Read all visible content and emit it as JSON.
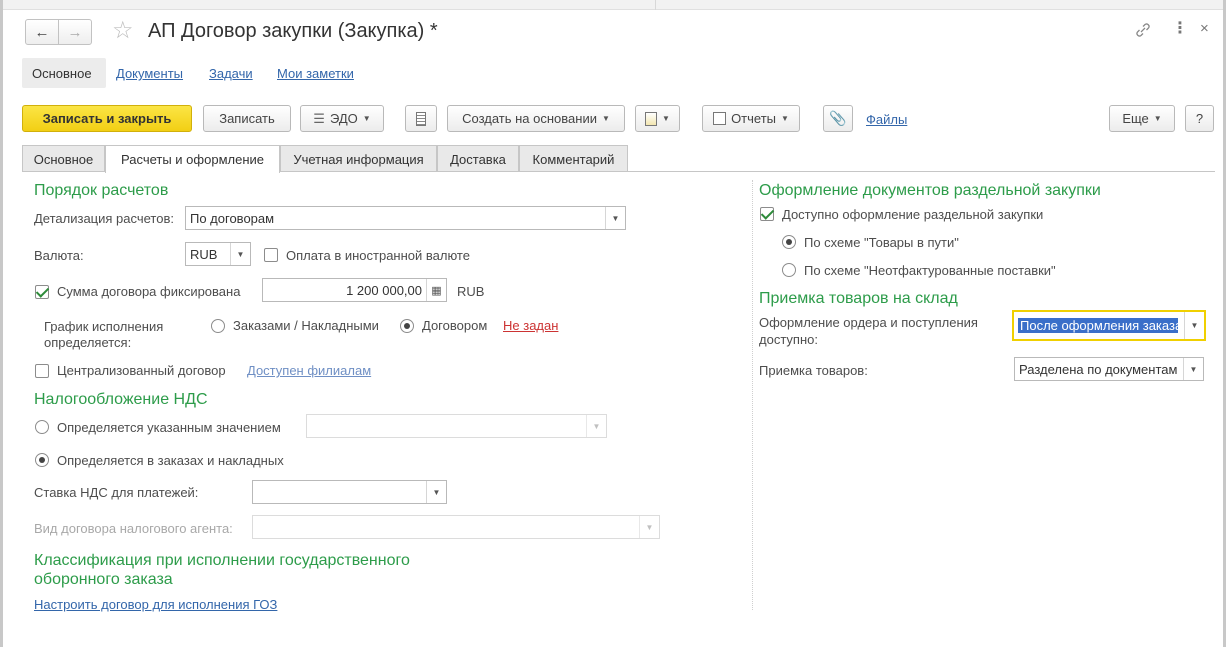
{
  "window": {
    "title": "АП Договор закупки (Закупка) *"
  },
  "nav_tabs": {
    "main": "Основное",
    "documents": "Документы",
    "tasks": "Задачи",
    "notes": "Мои заметки"
  },
  "toolbar": {
    "save_close": "Записать и закрыть",
    "save": "Записать",
    "edo": "ЭДО",
    "create_based": "Создать на основании",
    "reports": "Отчеты",
    "files": "Файлы",
    "more": "Еще",
    "help": "?"
  },
  "tabs": [
    "Основное",
    "Расчеты и оформление",
    "Учетная информация",
    "Доставка",
    "Комментарий"
  ],
  "left": {
    "settlement_section": "Порядок расчетов",
    "detail_label": "Детализация расчетов:",
    "detail_value": "По договорам",
    "currency_label": "Валюта:",
    "currency_value": "RUB",
    "foreign_payment_label": "Оплата в иностранной валюте",
    "foreign_payment_checked": false,
    "fixed_sum_label": "Сумма договора фиксирована",
    "fixed_sum_checked": true,
    "sum_value": "1 200 000,00",
    "sum_currency": "RUB",
    "schedule_label_1": "График исполнения",
    "schedule_label_2": "определяется:",
    "schedule_opt1": "Заказами / Накладными",
    "schedule_opt2": "Договором",
    "schedule_selected": "Договором",
    "schedule_link": "Не задан",
    "centralized_label": "Централизованный договор",
    "centralized_checked": false,
    "centralized_link": "Доступен филиалам",
    "vat_section": "Налогообложение НДС",
    "vat_opt1": "Определяется указанным значением",
    "vat_opt2": "Определяется в заказах и накладных",
    "vat_selected": "Определяется в заказах и накладных",
    "vat_rate_label": "Ставка НДС для платежей:",
    "vat_rate_value": "",
    "tax_agent_label": "Вид договора налогового агента:",
    "tax_agent_value": "",
    "goz_section_1": "Классификация при исполнении государственного",
    "goz_section_2": "оборонного заказа",
    "goz_link": "Настроить договор для исполнения ГОЗ"
  },
  "right": {
    "separate_section": "Оформление документов раздельной закупки",
    "separate_available_label": "Доступно оформление раздельной закупки",
    "separate_available_checked": true,
    "scheme_opt1": "По схеме \"Товары в пути\"",
    "scheme_opt2": "По схеме \"Неотфактурованные поставки\"",
    "scheme_selected": "По схеме \"Товары в пути\"",
    "warehouse_section": "Приемка товаров на склад",
    "order_label_1": "Оформление ордера и поступления",
    "order_label_2": "доступно:",
    "order_value": "После оформления заказа",
    "acceptance_label": "Приемка товаров:",
    "acceptance_value": "Разделена по документам"
  },
  "colors": {
    "section_green": "#2d9c4a",
    "primary_yellow": "#f2cf14",
    "link_blue": "#3366aa",
    "link_red": "#cc3333",
    "focus_yellow": "#f0d000"
  }
}
